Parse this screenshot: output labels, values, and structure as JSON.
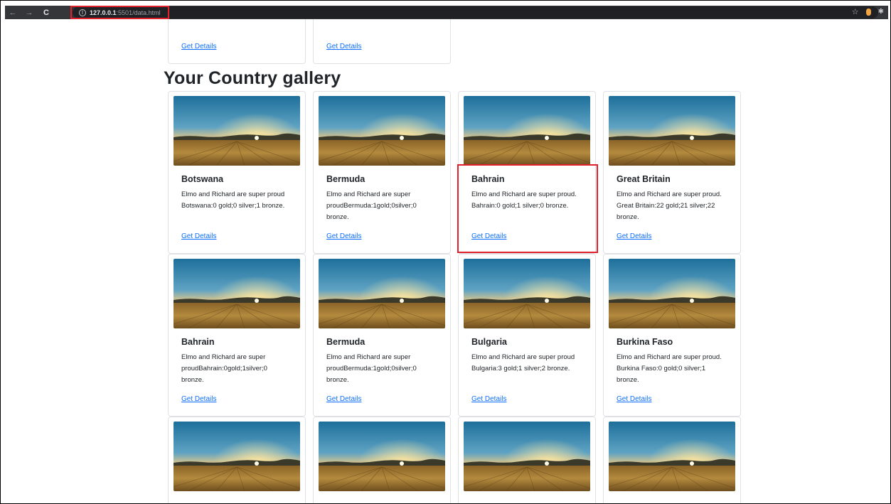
{
  "browser": {
    "url_host": "127.0.0.1",
    "url_path": ":5501/data.html",
    "accent_highlight_color": "#e0202a",
    "icons": [
      "back-arrow-icon",
      "forward-arrow-icon",
      "reload-icon",
      "site-info-icon",
      "bookmark-star-icon",
      "extension-icon",
      "puzzle-icon"
    ]
  },
  "top_stub_cards": [
    {
      "link": "Get Details"
    },
    {
      "link": "Get Details"
    }
  ],
  "gallery": {
    "heading": "Your Country gallery",
    "cards": [
      {
        "title": "Botswana",
        "text": "Elmo and Richard are super proud Botswana:0 gold;0 silver;1 bronze.",
        "link": "Get Details"
      },
      {
        "title": "Bermuda",
        "text": "Elmo and Richard are super proudBermuda:1gold;0silver;0 bronze.",
        "link": "Get Details"
      },
      {
        "title": "Bahrain",
        "text": "Elmo and Richard are super proud. Bahrain:0 gold;1 silver;0 bronze.",
        "link": "Get Details"
      },
      {
        "title": "Great Britain",
        "text": "Elmo and Richard are super proud. Great Britain:22 gold;21 silver;22 bronze.",
        "link": "Get Details"
      },
      {
        "title": "Bahrain",
        "text": "Elmo and Richard are super proudBahrain:0gold;1silver;0 bronze.",
        "link": "Get Details"
      },
      {
        "title": "Bermuda",
        "text": "Elmo and Richard are super proudBermuda:1gold;0silver;0 bronze.",
        "link": "Get Details"
      },
      {
        "title": "Bulgaria",
        "text": "Elmo and Richard are super proud Bulgaria:3 gold;1 silver;2 bronze.",
        "link": "Get Details"
      },
      {
        "title": "Burkina Faso",
        "text": "Elmo and Richard are super proud. Burkina Faso:0 gold;0 silver;1 bronze.",
        "link": "Get Details"
      }
    ]
  }
}
